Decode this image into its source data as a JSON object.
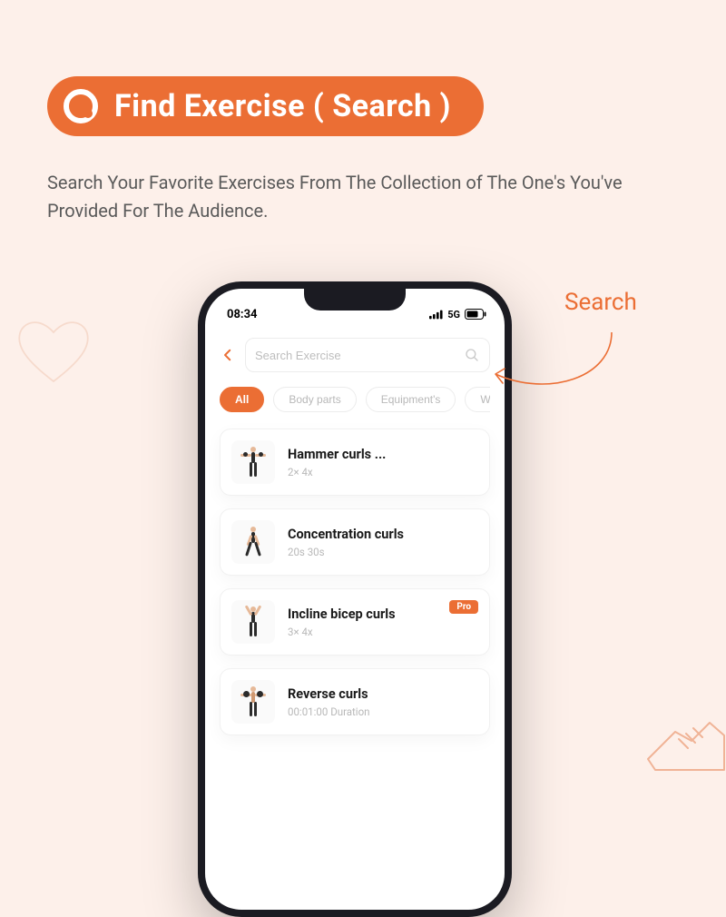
{
  "promo": {
    "title": "Find Exercise ( Search )",
    "subtitle": "Search Your Favorite Exercises From The Collection of The One's You've Provided For The Audience.",
    "callout_label": "Search"
  },
  "colors": {
    "accent": "#eb6e34",
    "page_bg": "#fdf0ea"
  },
  "phone": {
    "status": {
      "time": "08:34",
      "network": "5G"
    },
    "search": {
      "placeholder": "Search Exercise",
      "value": ""
    },
    "filters": [
      {
        "label": "All",
        "active": true
      },
      {
        "label": "Body parts",
        "active": false
      },
      {
        "label": "Equipment's",
        "active": false
      },
      {
        "label": "W",
        "active": false
      }
    ],
    "exercises": [
      {
        "title": "Hammer curls ...",
        "sub": "2× 4x",
        "badge": null,
        "icon": "arms-out"
      },
      {
        "title": "Concentration curls",
        "sub": "20s 30s",
        "badge": null,
        "icon": "arms-up"
      },
      {
        "title": "Incline bicep curls",
        "sub": "3× 4x",
        "badge": "Pro",
        "icon": "standing"
      },
      {
        "title": "Reverse curls",
        "sub": "00:01:00 Duration",
        "badge": null,
        "icon": "barbell"
      }
    ]
  }
}
